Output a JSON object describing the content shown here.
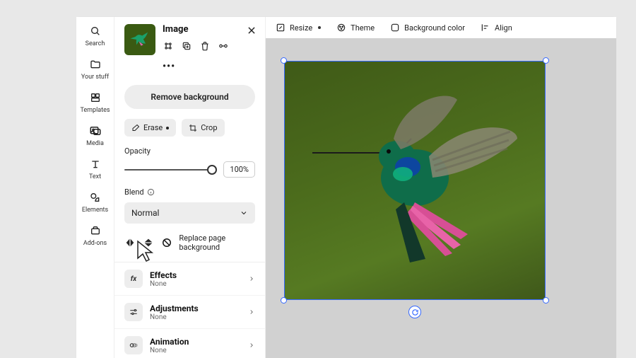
{
  "rail": [
    {
      "label": "Search",
      "icon": "search"
    },
    {
      "label": "Your stuff",
      "icon": "folder"
    },
    {
      "label": "Templates",
      "icon": "templates"
    },
    {
      "label": "Media",
      "icon": "media"
    },
    {
      "label": "Text",
      "icon": "text"
    },
    {
      "label": "Elements",
      "icon": "shapes"
    },
    {
      "label": "Add-ons",
      "icon": "addons"
    }
  ],
  "panel": {
    "title": "Image",
    "remove_bg": "Remove background",
    "erase": "Erase",
    "crop": "Crop",
    "opacity_label": "Opacity",
    "opacity_value": "100%",
    "blend_label": "Blend",
    "blend_value": "Normal",
    "replace_bg": "Replace page background",
    "sections": [
      {
        "title": "Effects",
        "sub": "None",
        "icon": "fx"
      },
      {
        "title": "Adjustments",
        "sub": "None",
        "icon": "sliders"
      },
      {
        "title": "Animation",
        "sub": "None",
        "icon": "anim"
      }
    ]
  },
  "topbar": {
    "resize": "Resize",
    "theme": "Theme",
    "bgcolor": "Background color",
    "align": "Align"
  }
}
